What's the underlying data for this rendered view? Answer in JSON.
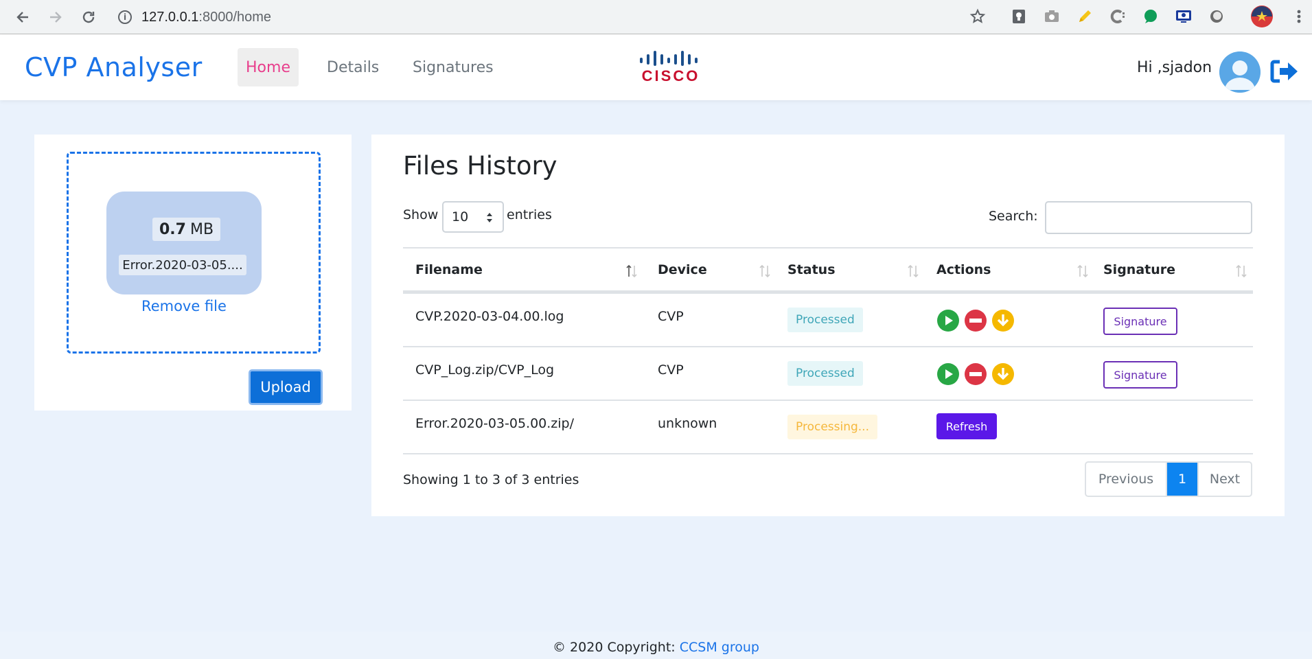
{
  "browser": {
    "url_host": "127.0.0.1",
    "url_path": ":8000/home",
    "icons": [
      "back-icon",
      "forward-icon",
      "reload-icon",
      "info-icon",
      "star-icon",
      "keep-icon",
      "camera-icon",
      "pencil-icon",
      "extension-c-icon",
      "green-dot-icon",
      "screen-icon",
      "circle-icon",
      "profile-icon",
      "menu-dots-icon"
    ]
  },
  "nav": {
    "brand": "CVP Analyser",
    "links": [
      "Home",
      "Details",
      "Signatures"
    ],
    "active": "Home",
    "logo_text": "CISCO",
    "greeting": "Hi ,sjadon"
  },
  "upload": {
    "size_value": "0.7",
    "size_unit": "MB",
    "file_name": "Error.2020-03-05....",
    "remove_label": "Remove file",
    "upload_label": "Upload"
  },
  "files": {
    "title": "Files History",
    "show_label": "Show",
    "page_length": "10",
    "entries_label": "entries",
    "search_label": "Search:",
    "search_value": "",
    "columns": [
      "Filename",
      "Device",
      "Status",
      "Actions",
      "Signature"
    ],
    "rows": [
      {
        "filename": "CVP.2020-03-04.00.log",
        "device": "CVP",
        "status": "Processed",
        "status_type": "done",
        "actions": [
          "play",
          "stop",
          "download"
        ],
        "signature": "Signature"
      },
      {
        "filename": "CVP_Log.zip/CVP_Log",
        "device": "CVP",
        "status": "Processed",
        "status_type": "done",
        "actions": [
          "play",
          "stop",
          "download"
        ],
        "signature": "Signature"
      },
      {
        "filename": "Error.2020-03-05.00.zip/",
        "device": "unknown",
        "status": "Processing...",
        "status_type": "busy",
        "actions": [
          "Refresh"
        ],
        "signature": ""
      }
    ],
    "info": "Showing 1 to 3 of 3 entries",
    "pagination": {
      "previous": "Previous",
      "current": "1",
      "next": "Next"
    }
  },
  "footer": {
    "copyright": "© 2020 Copyright:",
    "link": "CCSM group"
  },
  "colors": {
    "primary": "#1a73e8",
    "active_nav": "#e83e8c",
    "signature": "#6a2fb5",
    "refresh": "#5b18e8",
    "play": "#28a745",
    "stop": "#dc3545",
    "download": "#f5b800"
  }
}
